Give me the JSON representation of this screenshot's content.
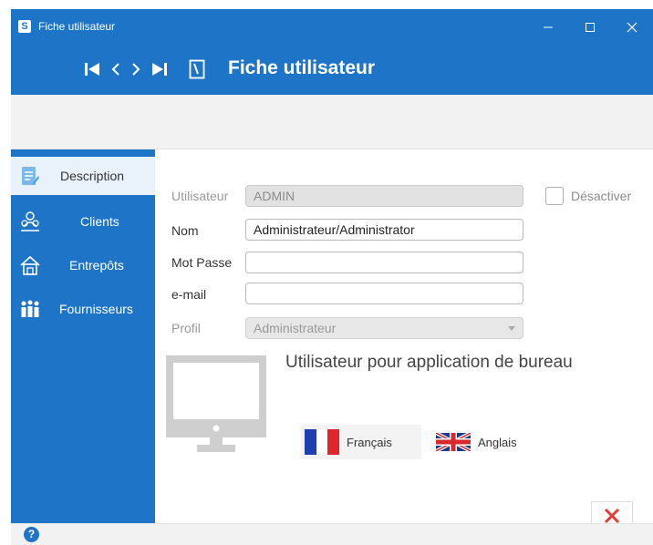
{
  "window": {
    "title": "Fiche utilisateur",
    "app_icon": "S"
  },
  "header": {
    "title": "Fiche utilisateur"
  },
  "sidebar": {
    "items": [
      {
        "label": "Description",
        "icon": "document-icon",
        "active": true
      },
      {
        "label": "Clients",
        "icon": "clients-icon"
      },
      {
        "label": "Entrepôts",
        "icon": "warehouse-icon"
      },
      {
        "label": "Fournisseurs",
        "icon": "suppliers-icon"
      }
    ]
  },
  "form": {
    "utilisateur": {
      "label": "Utilisateur",
      "value": "ADMIN"
    },
    "nom": {
      "label": "Nom",
      "value": "Administrateur/Administrator"
    },
    "mot_passe": {
      "label": "Mot Passe",
      "value": ""
    },
    "email": {
      "label": "e-mail",
      "value": ""
    },
    "profil": {
      "label": "Profil",
      "value": "Administrateur"
    },
    "desactiver": {
      "label": "Désactiver",
      "checked": false
    }
  },
  "desktop_app": {
    "label": "Utilisateur pour application de bureau"
  },
  "languages": [
    {
      "label": "Français",
      "flag": "france-flag-icon"
    },
    {
      "label": "Anglais",
      "flag": "uk-flag-icon"
    }
  ],
  "colors": {
    "accent": "#1e74c6",
    "close_red": "#e53935"
  }
}
